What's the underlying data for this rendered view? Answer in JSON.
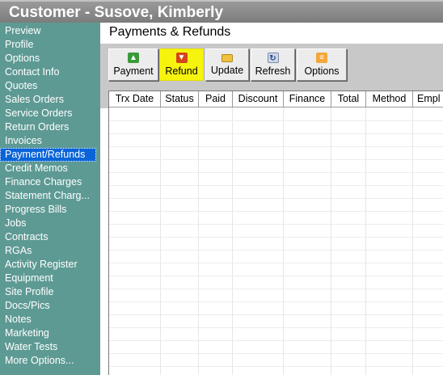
{
  "window": {
    "title": "Customer - Susove, Kimberly"
  },
  "sidebar": {
    "items": [
      "Preview",
      "Profile",
      "Options",
      "Contact Info",
      "Quotes",
      "Sales Orders",
      "Service Orders",
      "Return Orders",
      "Invoices",
      "Payment/Refunds",
      "Credit Memos",
      "Finance Charges",
      "Statement Charg...",
      "Progress Bills",
      "Jobs",
      "Contracts",
      "RGAs",
      "Activity Register",
      "Equipment",
      "Site Profile",
      "Docs/Pics",
      "Notes",
      "Marketing",
      "Water Tests",
      "More Options..."
    ],
    "active": "Payment/Refunds"
  },
  "section": {
    "title": "Payments & Refunds"
  },
  "toolbar": {
    "payment_label": "Payment",
    "refund_label": "Refund",
    "update_label": "Update",
    "refresh_label": "Refresh",
    "options_label": "Options"
  },
  "icons": {
    "payment": "up-arrow-icon",
    "refund": "down-arrow-icon",
    "update": "folder-icon",
    "refresh": "refresh-icon",
    "options": "options-icon"
  },
  "table": {
    "columns": [
      "Trx Date",
      "Status",
      "Paid",
      "Discount",
      "Finance",
      "Total",
      "Method",
      "Empl"
    ],
    "rows": []
  },
  "colors": {
    "sidebar_bg": "#5e9a94",
    "active_item": "#0a64d8",
    "highlight": "#f6f40e",
    "titlebar": "#8a8a8a"
  }
}
